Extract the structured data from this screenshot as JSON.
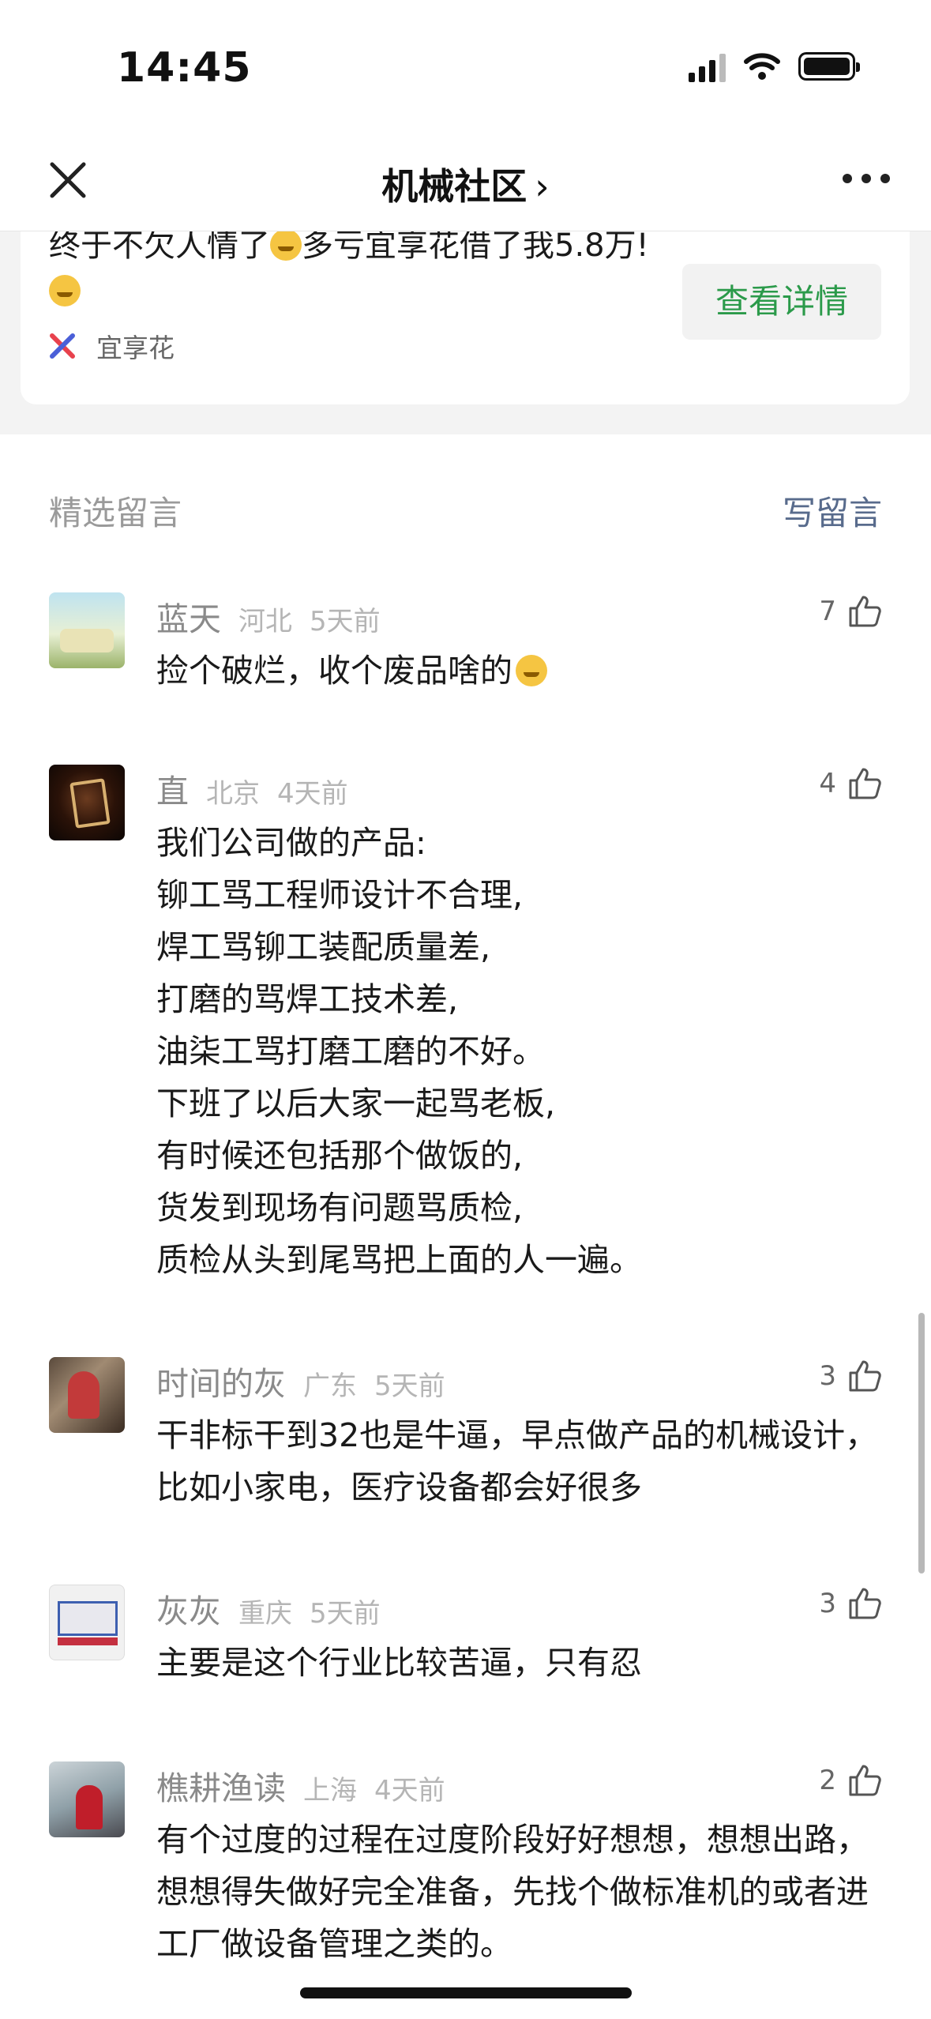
{
  "status_bar": {
    "time": "14:45"
  },
  "nav": {
    "title": "机械社区",
    "chevron": "›"
  },
  "ad": {
    "text_part1": "终于不欠人情了",
    "text_part2": "多亏宜享花借了我5.8万!",
    "brand": "宜享花",
    "button": "查看详情",
    "brand_color": "#2b9a4a"
  },
  "comments_section": {
    "title": "精选留言",
    "write": "写留言"
  },
  "comments": [
    {
      "name": "蓝天",
      "location": "河北",
      "time": "5天前",
      "likes": "7",
      "text": "捡个破烂，收个废品啥的"
    },
    {
      "name": "直",
      "location": "北京",
      "time": "4天前",
      "likes": "4",
      "text": "我们公司做的产品:\n铆工骂工程师设计不合理,\n焊工骂铆工装配质量差,\n打磨的骂焊工技术差,\n油柒工骂打磨工磨的不好。\n下班了以后大家一起骂老板,\n有时候还包括那个做饭的,\n货发到现场有问题骂质检,\n质检从头到尾骂把上面的人一遍。"
    },
    {
      "name": "时间的灰",
      "location": "广东",
      "time": "5天前",
      "likes": "3",
      "text": "干非标干到32也是牛逼，早点做产品的机械设计，比如小家电，医疗设备都会好很多"
    },
    {
      "name": "灰灰",
      "location": "重庆",
      "time": "5天前",
      "likes": "3",
      "text": "主要是这个行业比较苦逼，只有忍"
    },
    {
      "name": "樵耕渔读",
      "location": "上海",
      "time": "4天前",
      "likes": "2",
      "text": "有个过度的过程在过度阶段好好想想，想想出路，想想得失做好完全准备，先找个做标准机的或者进工厂做设备管理之类的。"
    }
  ]
}
